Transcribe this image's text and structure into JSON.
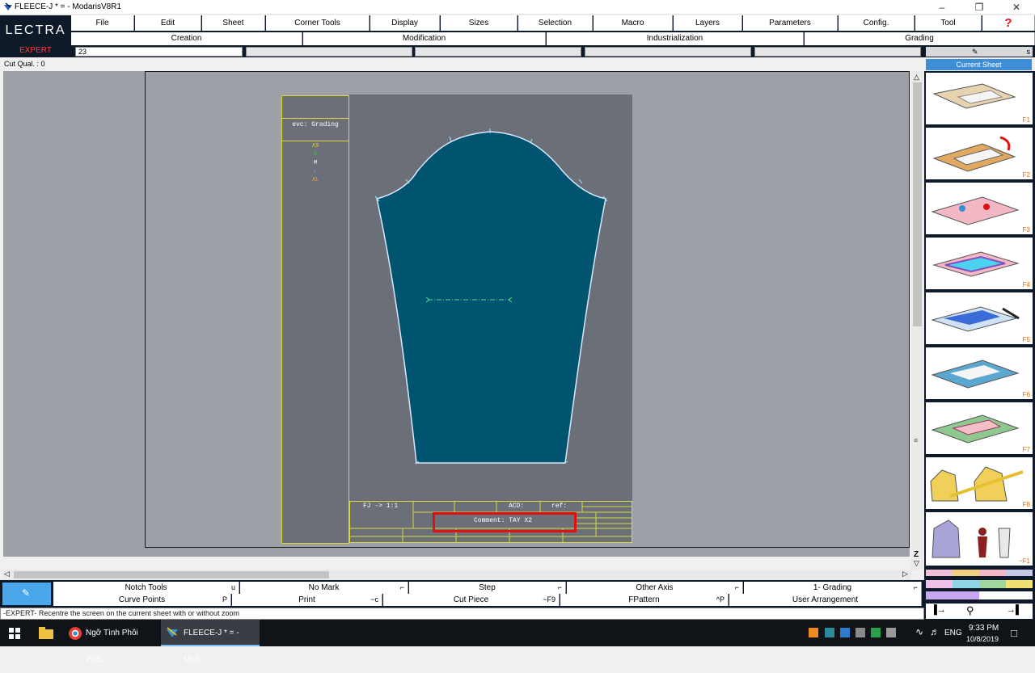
{
  "window": {
    "title": "FLEECE-J * = - ModarisV8R1"
  },
  "logo": "LECTRA",
  "mode_badge": "EXPERT",
  "menu": [
    "File",
    "Edit",
    "Sheet",
    "Corner Tools",
    "Display",
    "Sizes",
    "Selection",
    "Macro",
    "Layers",
    "Parameters",
    "Config.",
    "Tool"
  ],
  "submenu": [
    "Creation",
    "Modification",
    "Industrialization",
    "Grading"
  ],
  "input": {
    "value": "23"
  },
  "cut_quality": "Cut Qual. : 0",
  "right_panel": {
    "header_key": "s",
    "current_sheet": "Current Sheet",
    "fkeys": [
      "F1",
      "F2",
      "F3",
      "F4",
      "F5",
      "F6",
      "F7",
      "F8",
      "~F1"
    ]
  },
  "sheet": {
    "evc_label": "evc: Grading",
    "sizes": [
      {
        "name": "XS",
        "color": "#e6d629"
      },
      {
        "name": "S",
        "color": "#3cc63c"
      },
      {
        "name": "M",
        "color": "#ffffff"
      },
      {
        "name": "L",
        "color": "#d070d0"
      },
      {
        "name": "XL",
        "color": "#f0a030"
      }
    ],
    "title_block": {
      "scale": "FJ -> 1:1",
      "acd": "ACD:",
      "ref": "ref:",
      "comment": "Comment: TAY X2"
    }
  },
  "bottom_row1": [
    {
      "label": "Notch Tools",
      "key": "u"
    },
    {
      "label": "No Mark",
      "key": "⌐"
    },
    {
      "label": "Step",
      "key": "⌐"
    },
    {
      "label": "Other Axis",
      "key": "⌐"
    },
    {
      "label": "1- Grading",
      "key": "⌐"
    }
  ],
  "bottom_row2": [
    {
      "label": "Curve Points",
      "key": "P"
    },
    {
      "label": "Print",
      "key": "~c"
    },
    {
      "label": "Cut Piece",
      "key": "~F9"
    },
    {
      "label": "FPattern",
      "key": "^P"
    },
    {
      "label": "User Arrangement",
      "key": ""
    }
  ],
  "status": "-EXPERT- Recentre the screen on the current sheet with or without zoom",
  "taskbar": {
    "items": [
      "Ngỡ Tình Phôi Phai...",
      "FLEECE-J * = - Mod..."
    ],
    "lang": "ENG",
    "time": "9:33 PM",
    "date": "10/8/2019"
  },
  "colors": {
    "piece_fill": "#00546f",
    "piece_outline": "#d9e7ff",
    "frame": "#d8d83a",
    "highlight": "#e01010"
  }
}
